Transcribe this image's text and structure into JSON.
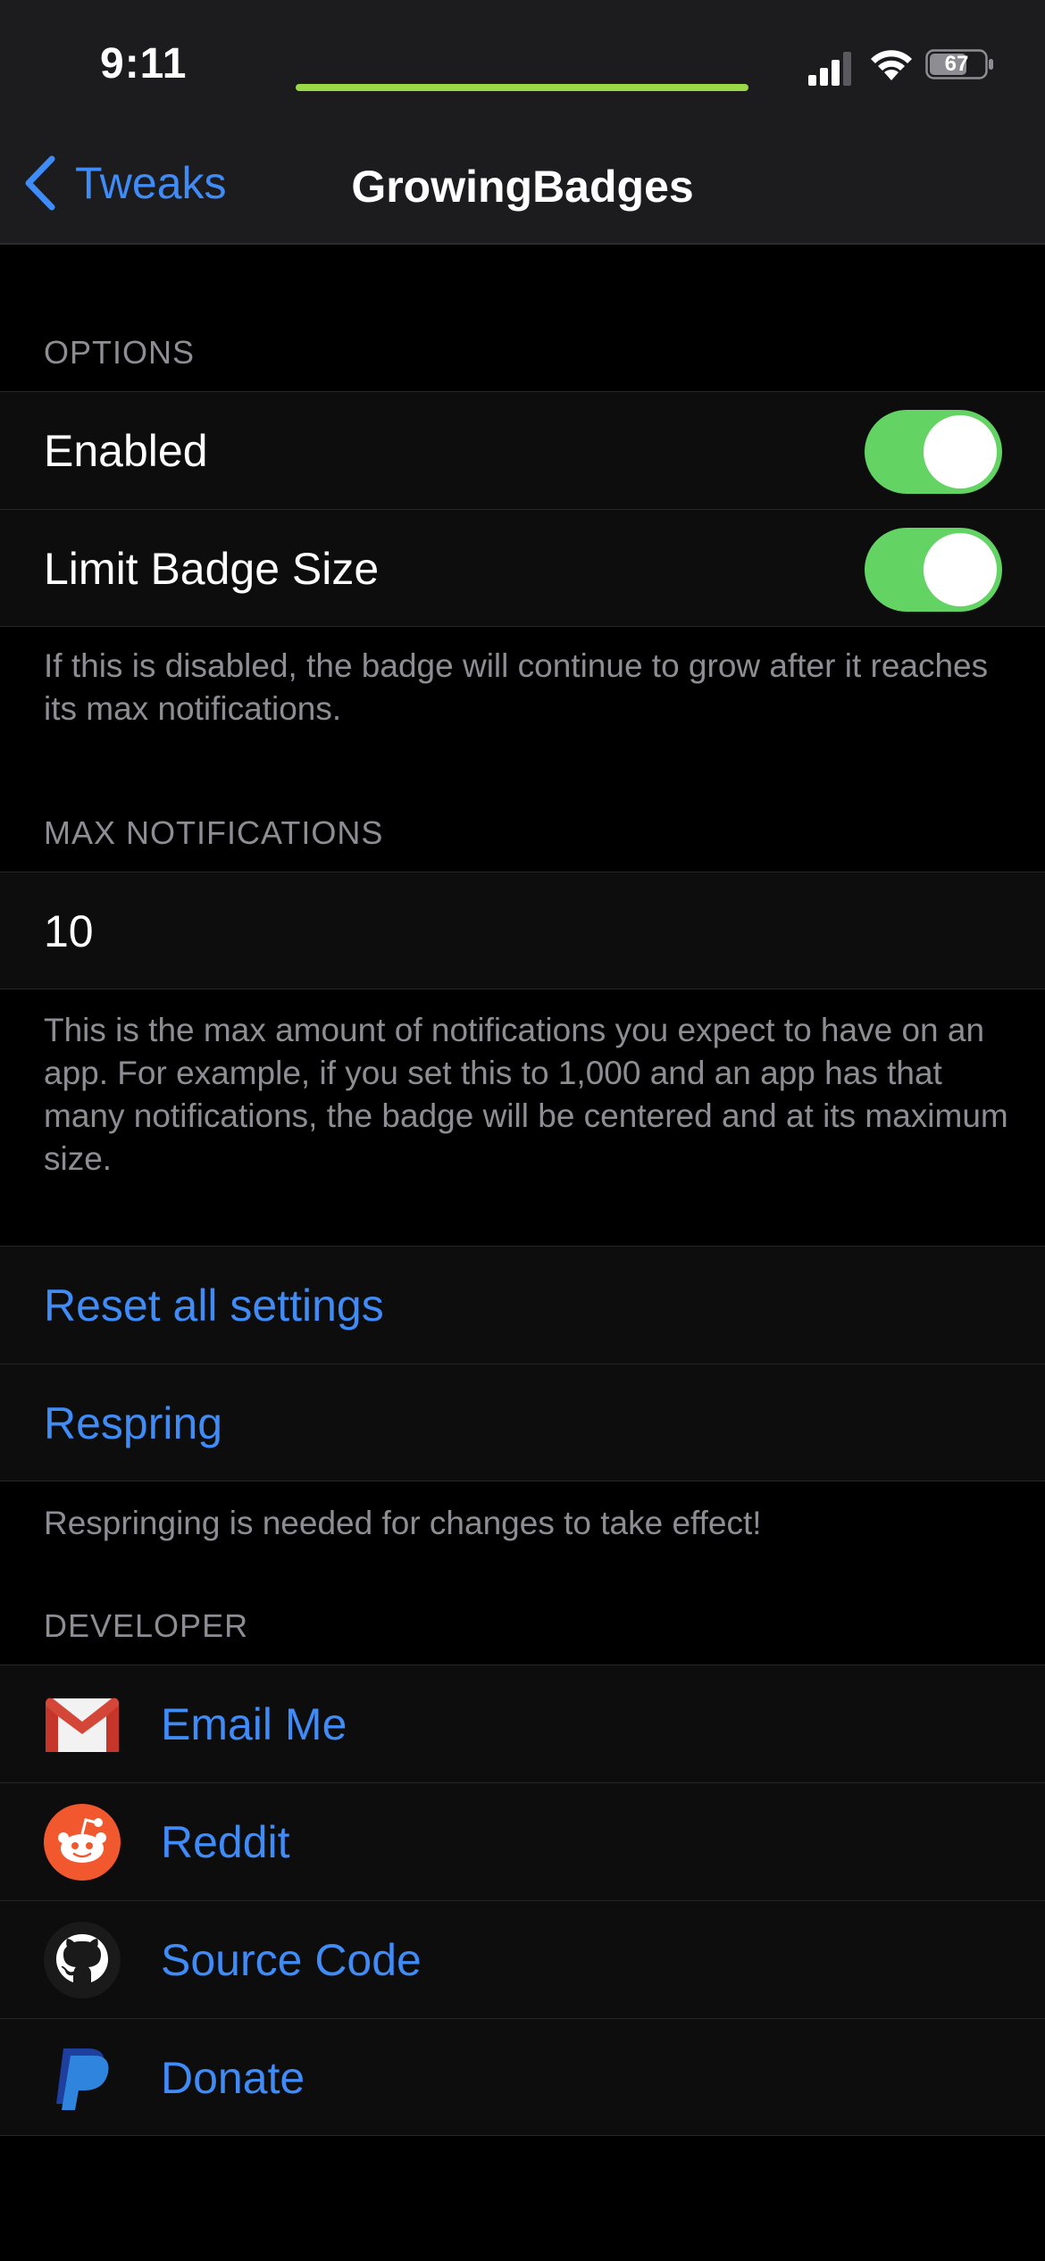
{
  "status_bar": {
    "time": "9:11",
    "battery": "67",
    "call_bar_color": "#9ad749",
    "icons": [
      "signal-icon",
      "wifi-icon",
      "battery-icon"
    ]
  },
  "nav": {
    "back_label": "Tweaks",
    "title": "GrowingBadges",
    "accent_color": "#3f8bf7"
  },
  "sections": {
    "options": {
      "header": "OPTIONS",
      "enabled_label": "Enabled",
      "enabled_on": true,
      "limit_label": "Limit Badge Size",
      "limit_on": true,
      "footer": "If this is disabled, the badge will continue to grow after it reaches its max notifications."
    },
    "max_notifications": {
      "header": "MAX NOTIFICATIONS",
      "value": "10",
      "footer": "This is the max amount of notifications you expect to have on an app. For example, if you set this to 1,000 and an app has that many notifications, the badge will be centered and at its maximum size."
    },
    "actions": {
      "reset_label": "Reset all settings",
      "respring_label": "Respring",
      "footer": "Respringing is needed for changes to take effect!"
    },
    "developer": {
      "header": "DEVELOPER",
      "items": [
        {
          "label": "Email Me",
          "icon": "gmail-icon"
        },
        {
          "label": "Reddit",
          "icon": "reddit-icon"
        },
        {
          "label": "Source Code",
          "icon": "github-icon"
        },
        {
          "label": "Donate",
          "icon": "paypal-icon"
        }
      ]
    }
  },
  "colors": {
    "toggle_on": "#63d364",
    "link": "#3f8bf7",
    "secondary_text": "#8d8d93",
    "background": "#000000"
  }
}
